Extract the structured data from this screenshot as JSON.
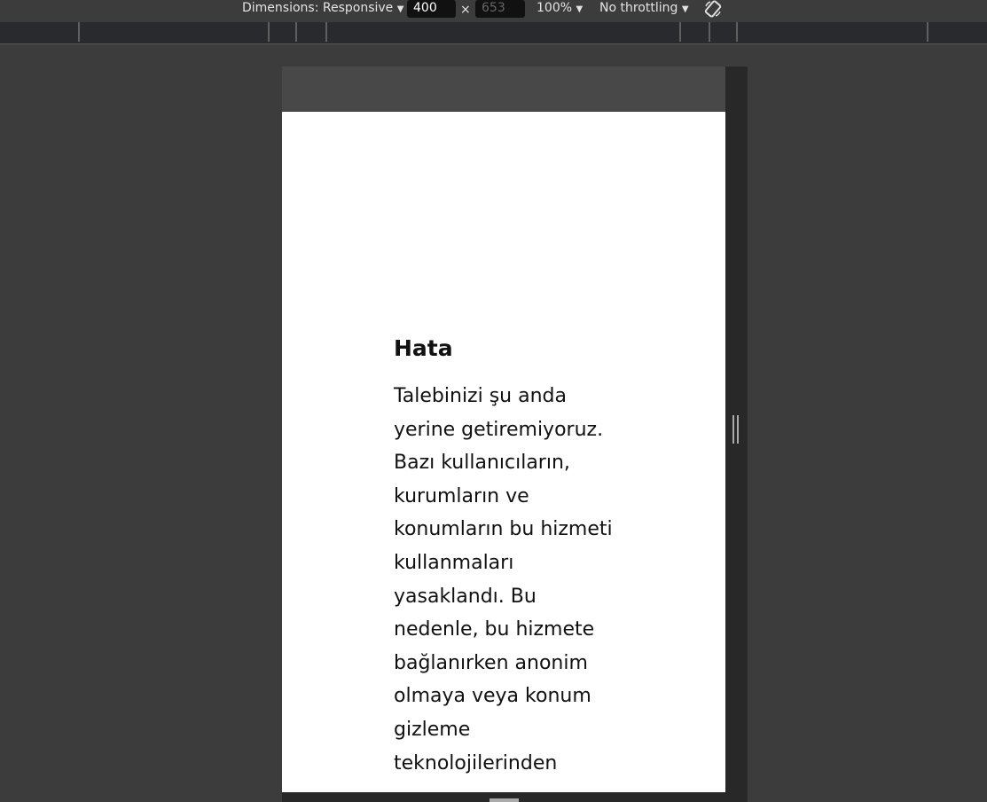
{
  "toolbar": {
    "dimensions_label": "Dimensions: Responsive",
    "width_value": "400",
    "times": "×",
    "height_value": "653",
    "zoom_label": "100%",
    "throttling_label": "No throttling",
    "rotate_icon": "rotate-icon",
    "dropdown_icon": "▼"
  },
  "page": {
    "title": "Hata",
    "lines": [
      "Talebinizi şu anda",
      "yerine getiremiyoruz.",
      "Bazı kullanıcıların,",
      "kurumların ve",
      "konumların bu hizmeti",
      "kullanmaları",
      "yasaklandı. Bu",
      "nedenle, bu hizmete",
      "bağlanırken anonim",
      "olmaya veya konum",
      "gizleme",
      "teknolojilerinden"
    ]
  }
}
